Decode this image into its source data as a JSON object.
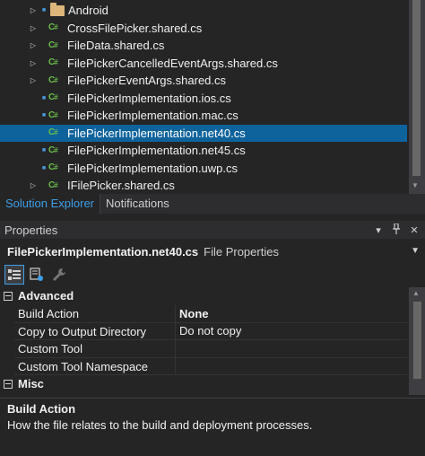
{
  "tree": {
    "items": [
      {
        "label": "Android",
        "kind": "folder",
        "lock": true,
        "expander": true
      },
      {
        "label": "CrossFilePicker.shared.cs",
        "kind": "cs",
        "lock": false,
        "expander": true
      },
      {
        "label": "FileData.shared.cs",
        "kind": "cs",
        "lock": false,
        "expander": true
      },
      {
        "label": "FilePickerCancelledEventArgs.shared.cs",
        "kind": "cs",
        "lock": false,
        "expander": true
      },
      {
        "label": "FilePickerEventArgs.shared.cs",
        "kind": "cs",
        "lock": false,
        "expander": true
      },
      {
        "label": "FilePickerImplementation.ios.cs",
        "kind": "cs",
        "lock": true,
        "expander": false
      },
      {
        "label": "FilePickerImplementation.mac.cs",
        "kind": "cs",
        "lock": true,
        "expander": false
      },
      {
        "label": "FilePickerImplementation.net40.cs",
        "kind": "cs",
        "lock": false,
        "expander": false,
        "selected": true
      },
      {
        "label": "FilePickerImplementation.net45.cs",
        "kind": "cs",
        "lock": true,
        "expander": false
      },
      {
        "label": "FilePickerImplementation.uwp.cs",
        "kind": "cs",
        "lock": true,
        "expander": false
      },
      {
        "label": "IFilePicker.shared.cs",
        "kind": "cs",
        "lock": false,
        "expander": true
      }
    ]
  },
  "tabs": {
    "solution_explorer": "Solution Explorer",
    "notifications": "Notifications"
  },
  "properties": {
    "title": "Properties",
    "object_name": "FilePickerImplementation.net40.cs",
    "object_type": "File Properties",
    "categories": {
      "advanced": "Advanced",
      "misc": "Misc"
    },
    "rows": [
      {
        "name": "Build Action",
        "value": "None",
        "bold": true
      },
      {
        "name": "Copy to Output Directory",
        "value": "Do not copy",
        "bold": false
      },
      {
        "name": "Custom Tool",
        "value": "",
        "bold": false
      },
      {
        "name": "Custom Tool Namespace",
        "value": "",
        "bold": false
      }
    ],
    "description": {
      "title": "Build Action",
      "text": "How the file relates to the build and deployment processes."
    }
  },
  "colors": {
    "selection": "#0e639c",
    "accent": "#3e9fe6",
    "cs_icon": "#6cbf4a",
    "folder": "#dcb67a"
  }
}
